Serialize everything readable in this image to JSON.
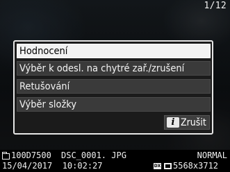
{
  "counter": "1/12",
  "menu": {
    "items": [
      {
        "label": "Hodnocení",
        "selected": true
      },
      {
        "label": "Výběr k odesl. na chytré zař./zrušení",
        "selected": false
      },
      {
        "label": "Retušování",
        "selected": false
      },
      {
        "label": "Výběr složky",
        "selected": false
      }
    ],
    "cancel": {
      "icon_letter": "i",
      "label": "Zrušit"
    }
  },
  "info": {
    "folder": "100D7500",
    "file": "DSC_0001. JPG",
    "quality": "NORMAL",
    "datetime": "15/04/2017  10:02:27",
    "format_badge": "DX",
    "image_size": "5568x3712"
  }
}
